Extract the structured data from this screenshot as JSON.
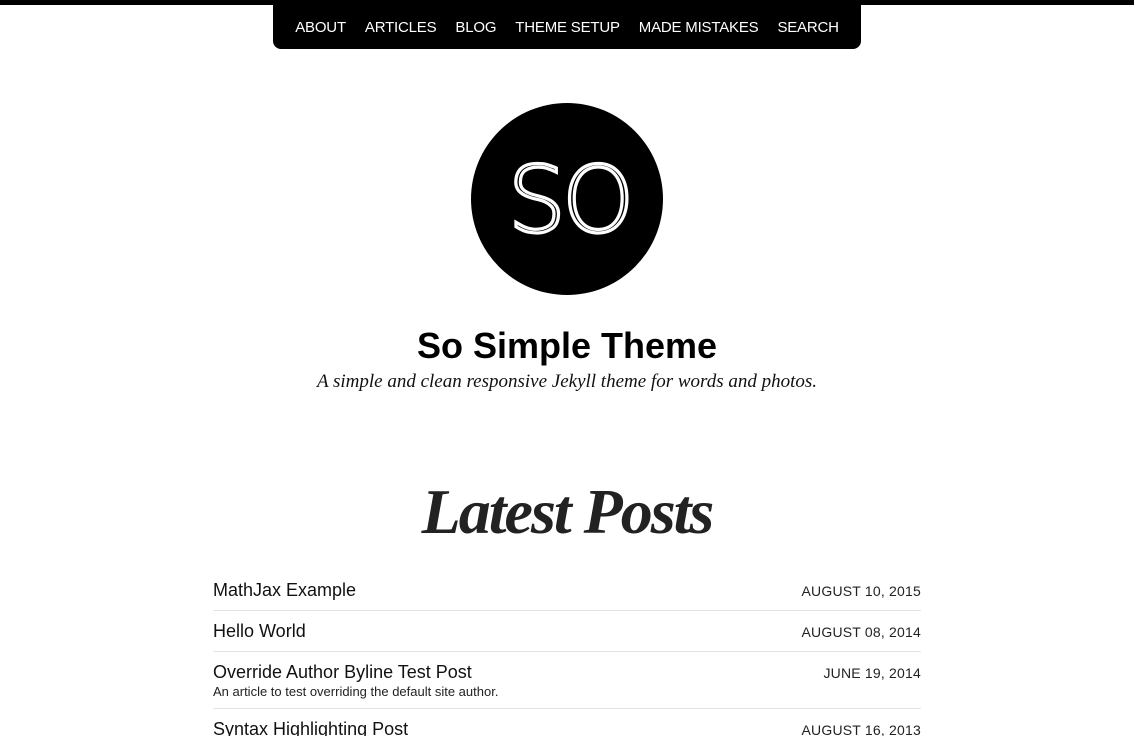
{
  "nav": {
    "items": [
      {
        "label": "ABOUT"
      },
      {
        "label": "ARTICLES"
      },
      {
        "label": "BLOG"
      },
      {
        "label": "THEME SETUP"
      },
      {
        "label": "MADE MISTAKES"
      },
      {
        "label": "SEARCH"
      }
    ]
  },
  "logo": {
    "text": "SO"
  },
  "site": {
    "title": "So Simple Theme",
    "description": "A simple and clean responsive Jekyll theme for words and photos."
  },
  "main": {
    "heading": "Latest Posts",
    "posts": [
      {
        "title": "MathJax Example",
        "date": "AUGUST 10, 2015",
        "excerpt": ""
      },
      {
        "title": "Hello World",
        "date": "AUGUST 08, 2014",
        "excerpt": ""
      },
      {
        "title": "Override Author Byline Test Post",
        "date": "JUNE 19, 2014",
        "excerpt": "An article to test overriding the default site author."
      },
      {
        "title": "Syntax Highlighting Post",
        "date": "AUGUST 16, 2013",
        "excerpt": ""
      }
    ]
  },
  "colors": {
    "primary": "#000000",
    "background": "#ffffff",
    "divider": "#e3e3e3"
  }
}
